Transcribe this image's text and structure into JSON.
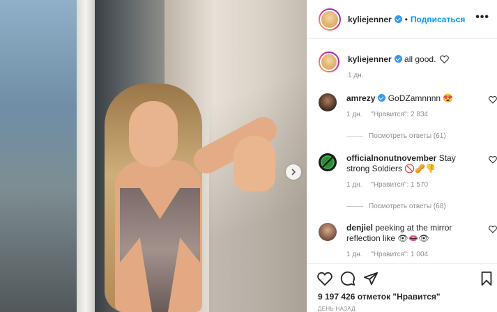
{
  "post": {
    "author": "kyliejenner",
    "follow_label": "Подписаться",
    "dot": "•",
    "more_label": "•••"
  },
  "caption": {
    "author": "kyliejenner",
    "text": "all good.",
    "age": "1 дн."
  },
  "comments": [
    {
      "author": "amrezy",
      "text": "GoDZamnnnn 😍",
      "age": "1 дн.",
      "likes": "\"Нравится\": 2 834",
      "replies": "Посмотреть ответы (61)"
    },
    {
      "author": "officialnonutnovember",
      "text": "Stay strong Soldiers 🚫🥜👎",
      "age": "1 дн.",
      "likes": "\"Нравится\": 1 570",
      "replies": "Посмотреть ответы (68)"
    },
    {
      "author": "denjiel",
      "text": "peeking at the mirror reflection like 👁👄👁",
      "age": "1 дн.",
      "likes": "\"Нравится\": 1 004"
    }
  ],
  "footer": {
    "likes": "9 197 426 отметок \"Нравится\"",
    "time": "День назад"
  },
  "colors": {
    "link": "#0095f6",
    "verified": "#3897f0",
    "meta": "#8e8e8e"
  }
}
